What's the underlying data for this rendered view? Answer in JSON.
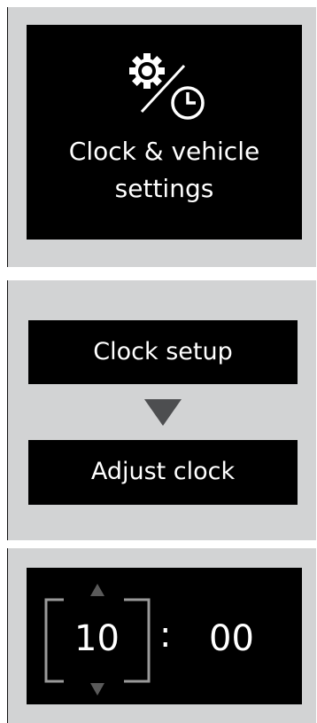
{
  "step1": {
    "title_line1": "Clock & vehicle",
    "title_line2": "settings",
    "icon": "gear-clock-icon"
  },
  "step2": {
    "menu_item": "Clock setup",
    "submenu_item": "Adjust clock",
    "arrow_icon": "down-triangle-icon"
  },
  "step3": {
    "hours": "10",
    "separator": ":",
    "minutes": "00"
  },
  "colors": {
    "panel_bg": "#d2d3d4",
    "screen_bg": "#000000",
    "text": "#ffffff",
    "arrow": "#4d4e50",
    "bracket": "#9a9a9a"
  }
}
